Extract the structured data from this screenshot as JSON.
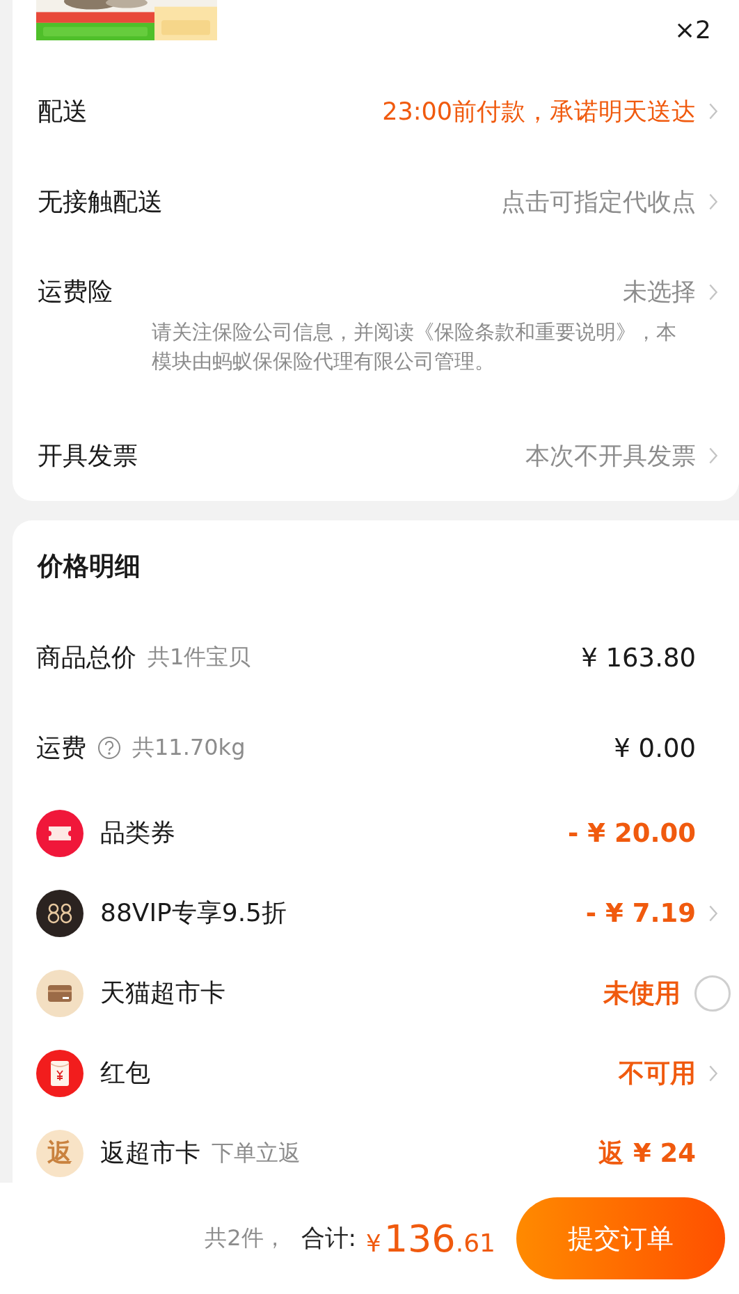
{
  "product": {
    "quantity": "×2"
  },
  "options": [
    {
      "label": "配送",
      "value": "23:00前付款，承诺明天送达",
      "highlighted": true,
      "chevron": true
    },
    {
      "label": "无接触配送",
      "value": "点击可指定代收点",
      "highlighted": false,
      "chevron": true
    },
    {
      "label": "运费险",
      "value": "未选择",
      "highlighted": false,
      "chevron": true,
      "note": "请关注保险公司信息，并阅读《保险条款和重要说明》，本模块由蚂蚁保保险代理有限公司管理。"
    },
    {
      "label": "开具发票",
      "value": "本次不开具发票",
      "highlighted": false,
      "chevron": true
    }
  ],
  "price": {
    "title": "价格明细",
    "rows": [
      {
        "kind": "plain",
        "label": "商品总价",
        "sub": "共1件宝贝",
        "help": false,
        "value": "¥ 163.80",
        "chevron": false
      },
      {
        "kind": "plain",
        "label": "运费",
        "sub": "共11.70kg",
        "help": true,
        "value": "¥ 0.00",
        "chevron": false
      },
      {
        "kind": "coupon",
        "label": "品类券",
        "value": "- ¥ 20.00",
        "chevron": false
      },
      {
        "kind": "vip",
        "label": "88VIP专享9.5折",
        "value": "- ¥ 7.19",
        "chevron": true
      },
      {
        "kind": "card",
        "label": "天猫超市卡",
        "value": "未使用",
        "chevron": false,
        "radio": {
          "checked": false
        }
      },
      {
        "kind": "redpacket",
        "label": "红包",
        "value": "不可用",
        "chevron": true
      },
      {
        "kind": "rebate",
        "badge": "返",
        "label": "返超市卡",
        "sub": "下单立返",
        "value": "返 ¥ 24",
        "chevron": false
      }
    ]
  },
  "footer": {
    "count": "共2件，",
    "total_label": "合计:",
    "currency": "¥",
    "total_int": "136",
    "total_dec": ".61",
    "submit": "提交订单"
  }
}
